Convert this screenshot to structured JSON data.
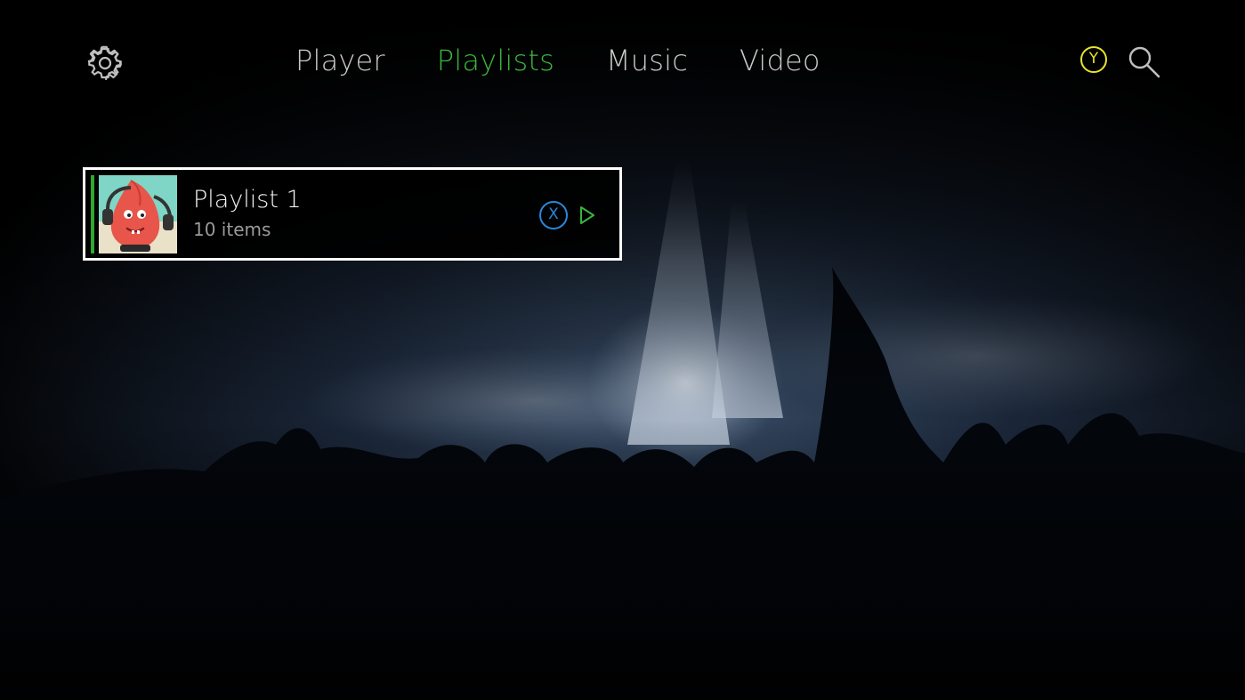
{
  "nav": {
    "tabs": [
      {
        "label": "Player",
        "active": false
      },
      {
        "label": "Playlists",
        "active": true
      },
      {
        "label": "Music",
        "active": false
      },
      {
        "label": "Video",
        "active": false
      }
    ],
    "y_button_label": "Y",
    "icons": {
      "settings": "gear-icon",
      "search": "search-icon"
    }
  },
  "playlists": [
    {
      "title": "Playlist 1",
      "subtitle": "10 items",
      "x_button_label": "X"
    }
  ],
  "colors": {
    "accent_green": "#3bb53b",
    "y_yellow": "#e8e42a",
    "x_blue": "#2a86d8",
    "focus_border": "#ffffff"
  }
}
